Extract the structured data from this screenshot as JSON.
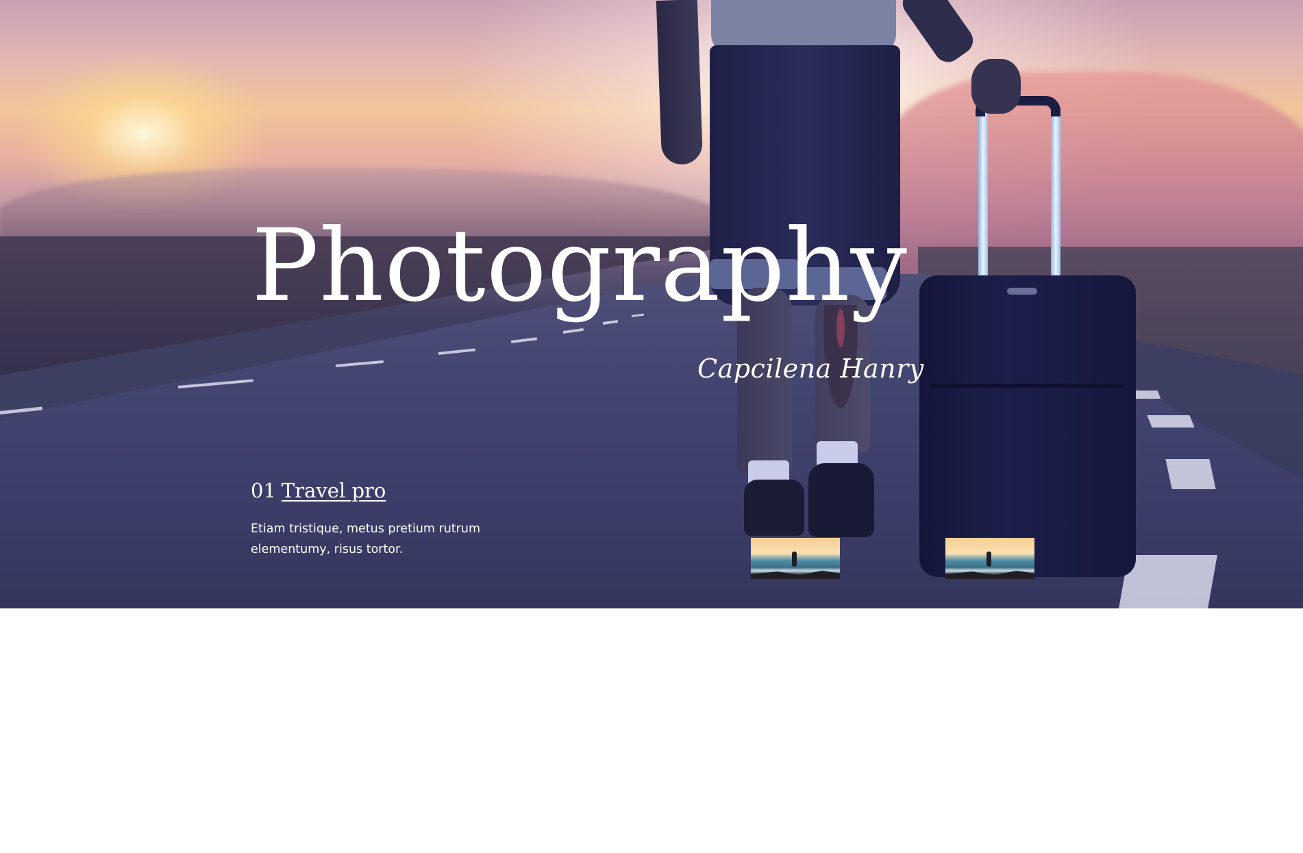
{
  "hero": {
    "title": "Photography",
    "signature": "Capcilena Hanry"
  },
  "slide": {
    "number": "01",
    "title": "Travel pro",
    "description": "Etiam tristique, metus pretium rutrum elementumy, risus tortor."
  },
  "thumbnails": [
    {
      "name": "sunset-sea"
    },
    {
      "name": "road-suitcase"
    },
    {
      "name": "sunset-sea-2"
    }
  ],
  "colors": {
    "text": "#ffffff",
    "road": "#3b3d68",
    "sky_glow": "#f2c59a"
  }
}
